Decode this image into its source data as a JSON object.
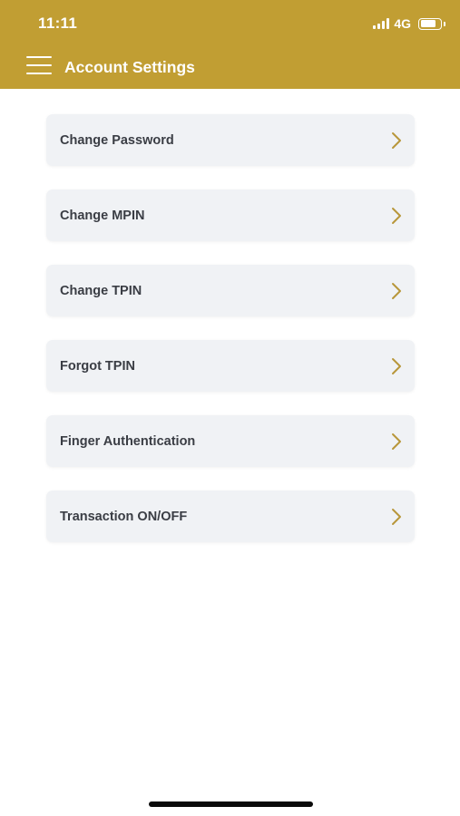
{
  "status_bar": {
    "time": "11:11",
    "network": "4G",
    "signal_icon": "cellular-signal-icon",
    "battery_icon": "battery-icon",
    "battery_level": 0.8
  },
  "header": {
    "title": "Account Settings",
    "menu_icon": "hamburger-menu-icon",
    "background_color": "#C19E33"
  },
  "menu": {
    "items": [
      {
        "label": "Change Password",
        "icon": "chevron-right-icon"
      },
      {
        "label": "Change MPIN",
        "icon": "chevron-right-icon"
      },
      {
        "label": "Change TPIN",
        "icon": "chevron-right-icon"
      },
      {
        "label": "Forgot TPIN",
        "icon": "chevron-right-icon"
      },
      {
        "label": "Finger Authentication",
        "icon": "chevron-right-icon"
      },
      {
        "label": "Transaction ON/OFF",
        "icon": "chevron-right-icon"
      }
    ],
    "item_background": "#F0F2F5",
    "chevron_color": "#B8973A"
  }
}
